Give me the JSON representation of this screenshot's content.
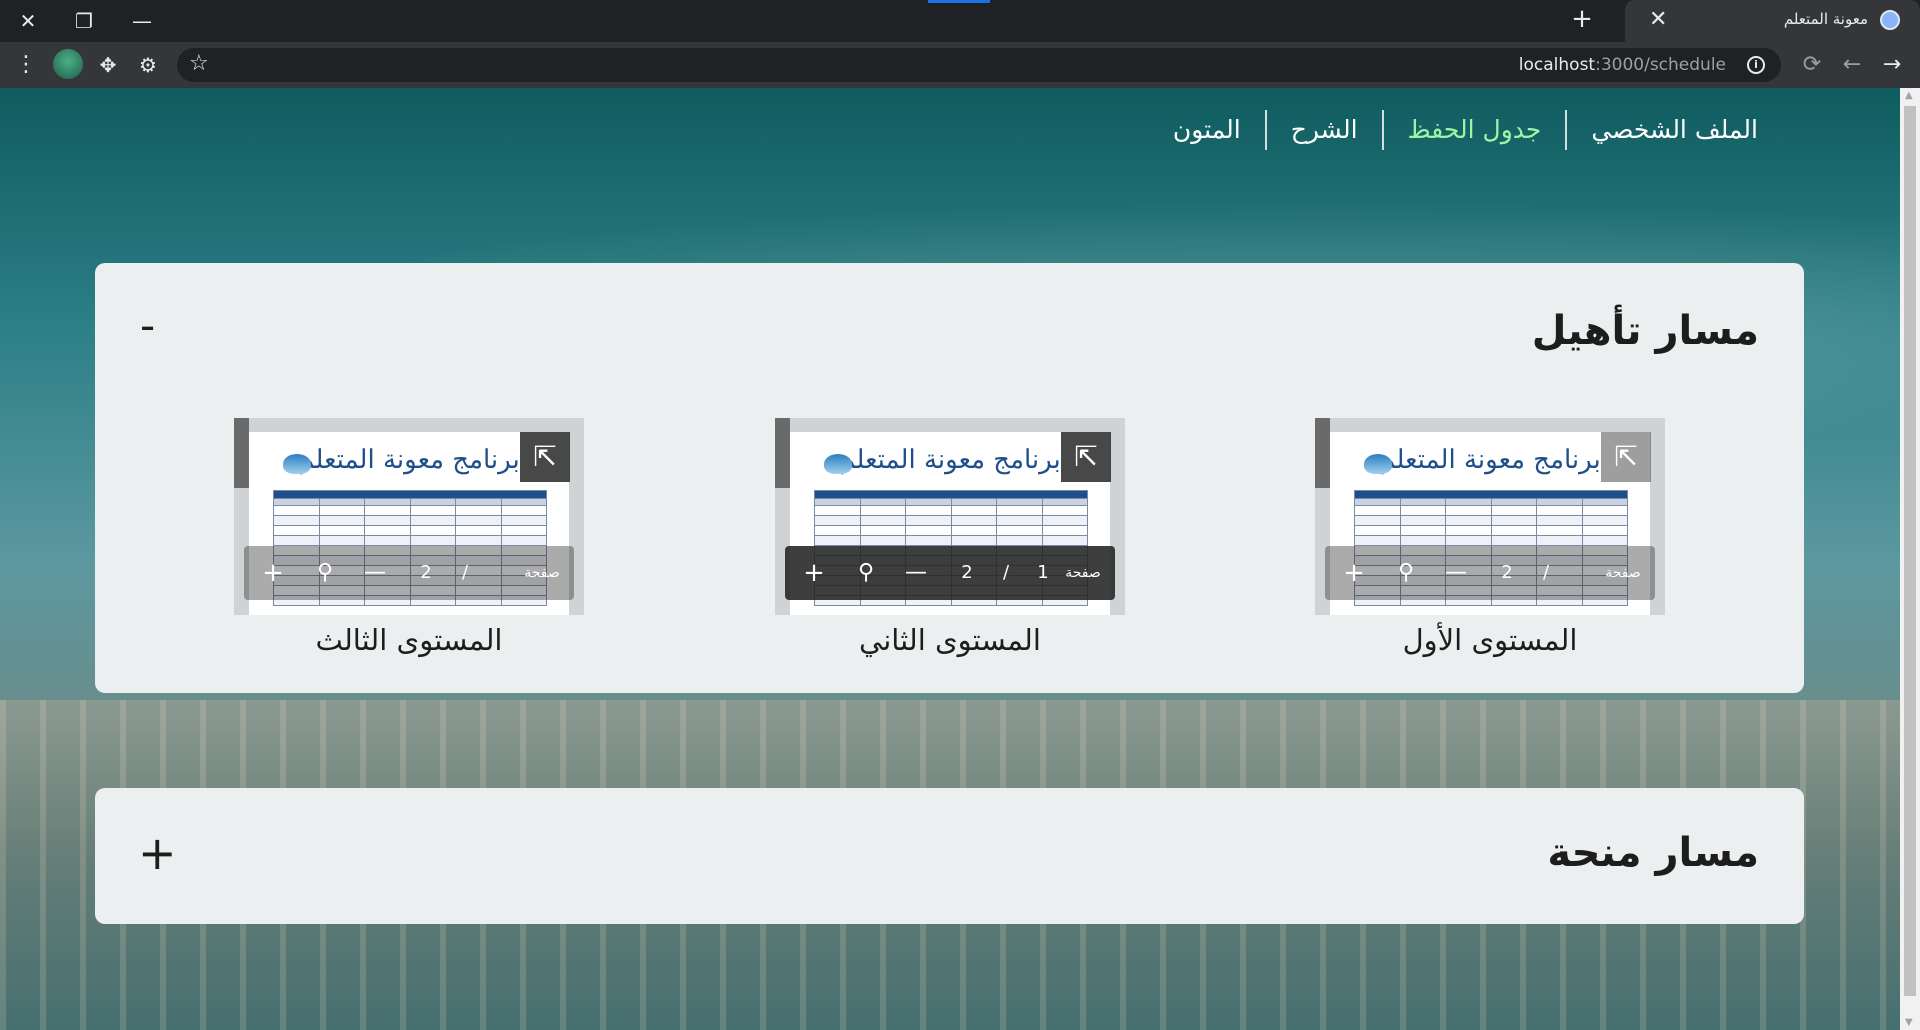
{
  "browser": {
    "tab_title": "معونة المتعلم",
    "url_host": "localhost",
    "url_path": ":3000/schedule"
  },
  "nav": {
    "items": [
      "المتون",
      "الشرح",
      "جدول الحفظ",
      "الملف الشخصي"
    ],
    "active": "جدول الحفظ",
    "active_color": "#9ff2a6"
  },
  "sections": [
    {
      "title": "مسار تأهيل",
      "toggle": "-",
      "levels": [
        {
          "label": "المستوى الأول",
          "pdf_header": "برنامج معونة المتعلم",
          "page_label": "صفحة",
          "page": "",
          "total": "2"
        },
        {
          "label": "المستوى الثاني",
          "pdf_header": "برنامج معونة المتعلم",
          "page_label": "صفحة",
          "page": "1",
          "total": "2"
        },
        {
          "label": "المستوى الثالث",
          "pdf_header": "برنامج معونة المتعلم",
          "page_label": "صفحة",
          "page": "",
          "total": "2"
        }
      ]
    },
    {
      "title": "مسار منحة",
      "toggle": "+"
    }
  ],
  "icons": {
    "close": "close-icon",
    "restore": "restore-icon",
    "minimize": "minimize-icon",
    "new_tab": "plus-icon",
    "menu": "kebab-menu-icon",
    "extensions": "puzzle-icon",
    "settings_ext": "gear-icon",
    "bookmark": "star-icon",
    "info": "info-icon",
    "reload": "reload-icon",
    "back": "back-arrow-icon",
    "forward": "forward-arrow-icon",
    "open_external": "open-external-icon",
    "zoom": "zoom-icon"
  }
}
